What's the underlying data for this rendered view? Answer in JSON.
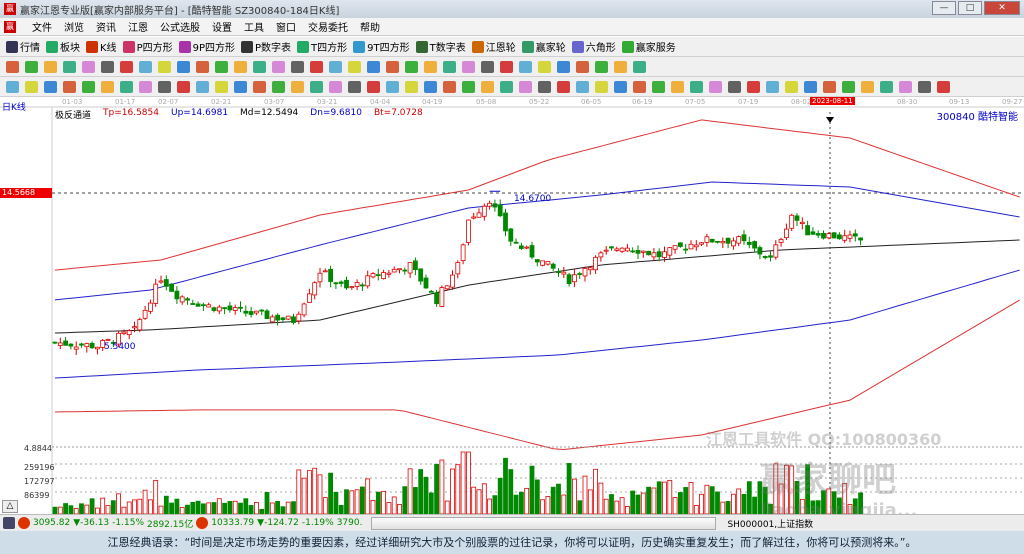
{
  "window": {
    "title": "赢家江恩专业版[赢家内部服务平台] - [酷特智能  SZ300840-184日K线]",
    "buttons": [
      "—",
      "□",
      "✕"
    ]
  },
  "menu": [
    "文件",
    "浏览",
    "资讯",
    "江恩",
    "公式选股",
    "设置",
    "工具",
    "窗口",
    "交易委托",
    "帮助"
  ],
  "toolbar1": [
    "行情",
    "板块",
    "K线",
    "P四方形",
    "9P四方形",
    "P数字表",
    "T四方形",
    "9T四方形",
    "T数字表",
    "江恩轮",
    "赢家轮",
    "六角形",
    "赢家服务"
  ],
  "toolbar1_colors": [
    "#335",
    "#2a6",
    "#c30",
    "#c36",
    "#a3a",
    "#333",
    "#2a6",
    "#39c",
    "#363",
    "#c60",
    "#396",
    "#66c",
    "#3a3"
  ],
  "chart_header": {
    "period": "日K线",
    "indicator": "极反通道",
    "tp": "Tp=16.5854",
    "up": "Up=14.6981",
    "md": "Md=12.5494",
    "dn": "Dn=9.6810",
    "bt": "Bt=7.0728",
    "stock": "300840  酷特智能"
  },
  "dates": [
    "01-03",
    "01-17",
    "02-07",
    "02-21",
    "03-07",
    "03-21",
    "04-04",
    "04-19",
    "05-08",
    "05-22",
    "06-05",
    "06-19",
    "07-05",
    "07-19",
    "08-02",
    "2023-08-11",
    "08-30",
    "09-13",
    "09-27"
  ],
  "price_label": "14.5668",
  "annotations": {
    "high": "14.6700",
    "low": "5.5400"
  },
  "volume_axis": [
    "4.8844",
    "259196",
    "172797",
    "86399"
  ],
  "chart_data": {
    "type": "candlestick",
    "title": "酷特智能 SZ300840 日K线",
    "ylim": [
      -0.5,
      19
    ],
    "close_keypoints": [
      [
        0,
        5.8
      ],
      [
        8,
        5.6
      ],
      [
        15,
        6.5
      ],
      [
        20,
        9.6
      ],
      [
        23,
        8.6
      ],
      [
        28,
        8.0
      ],
      [
        35,
        7.6
      ],
      [
        45,
        7.1
      ],
      [
        50,
        10.0
      ],
      [
        55,
        8.9
      ],
      [
        61,
        9.8
      ],
      [
        67,
        10.3
      ],
      [
        72,
        8.3
      ],
      [
        76,
        10.3
      ],
      [
        78,
        13.0
      ],
      [
        82,
        14.2
      ],
      [
        86,
        11.8
      ],
      [
        93,
        10.3
      ],
      [
        97,
        9.5
      ],
      [
        103,
        10.9
      ],
      [
        107,
        11.5
      ],
      [
        114,
        10.9
      ],
      [
        122,
        11.8
      ],
      [
        129,
        11.8
      ],
      [
        135,
        10.7
      ],
      [
        139,
        13.3
      ],
      [
        142,
        12.3
      ],
      [
        152,
        11.8
      ]
    ],
    "bands": {
      "red_upper": [
        [
          0,
          10.05
        ],
        [
          20,
          10.64
        ],
        [
          50,
          13.28
        ],
        [
          78,
          14.74
        ],
        [
          93,
          16.5
        ],
        [
          122,
          18.85
        ],
        [
          150,
          17.79
        ],
        [
          182,
          14.33
        ]
      ],
      "blue_upper": [
        [
          0,
          8.3
        ],
        [
          18,
          8.88
        ],
        [
          50,
          11.52
        ],
        [
          78,
          13.69
        ],
        [
          103,
          14.45
        ],
        [
          124,
          15.21
        ],
        [
          150,
          14.92
        ],
        [
          182,
          13.16
        ]
      ],
      "middle": [
        [
          0,
          6.36
        ],
        [
          18,
          6.54
        ],
        [
          50,
          7.12
        ],
        [
          78,
          9.17
        ],
        [
          103,
          10.35
        ],
        [
          137,
          11.23
        ],
        [
          182,
          11.81
        ]
      ],
      "blue_lower": [
        [
          0,
          3.72
        ],
        [
          27,
          4.19
        ],
        [
          65,
          4.66
        ],
        [
          95,
          5.07
        ],
        [
          122,
          5.95
        ],
        [
          150,
          7.12
        ],
        [
          182,
          10.05
        ]
      ],
      "red_lower": [
        [
          0,
          1.73
        ],
        [
          27,
          1.85
        ],
        [
          65,
          1.85
        ],
        [
          95,
          -0.5
        ],
        [
          122,
          0.38
        ],
        [
          150,
          2.43
        ],
        [
          182,
          8.29
        ]
      ]
    },
    "reference_price": 14.5668,
    "high": 14.67,
    "low": 5.54
  },
  "status": {
    "idx1": "3095.82",
    "chg1": "▼-36.13",
    "pct1": "-1.15%",
    "amt1": "2892.15亿",
    "idx2": "10333.79",
    "chg2": "▼-124.72",
    "pct2": "-1.19%",
    "amt2": "3790.",
    "code": "SH000001,上证指数"
  },
  "quote": "江恩经典语录：“时间是决定市场走势的重要因素，经过详细研究大市及个别股票的过往记录，你将可以证明，历史确实重复发生；而了解过往，你将可以预测将来。”。",
  "watermark": {
    "line1": "江恩工具软件  QQ:100800360",
    "line2": "赢家聊吧",
    "line3": "liaoba.yingjia..."
  }
}
